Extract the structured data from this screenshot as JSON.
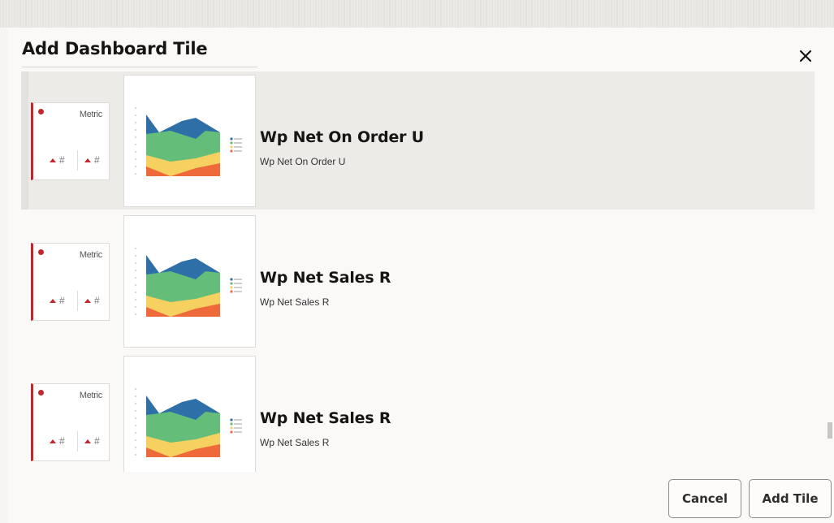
{
  "dialog": {
    "title": "Add Dashboard Tile",
    "close_icon": "close-icon"
  },
  "tiles": [
    {
      "name": "Wp Net On Order U",
      "description": "Wp Net On Order U",
      "selected": true
    },
    {
      "name": "Wp Net Sales R",
      "description": "Wp Net Sales R",
      "selected": false
    },
    {
      "name": "Wp Net Sales R",
      "description": "Wp Net Sales R",
      "selected": false
    }
  ],
  "metric_preview": {
    "label": "Metric",
    "value_placeholder": "#",
    "accent_color": "#c3262e"
  },
  "chart_preview_colors": {
    "series_blue": "#2e6fa8",
    "series_green": "#64be7a",
    "series_yellow": "#f7d15f",
    "series_orange": "#ef6a3a"
  },
  "footer": {
    "cancel_label": "Cancel",
    "add_label": "Add Tile"
  }
}
